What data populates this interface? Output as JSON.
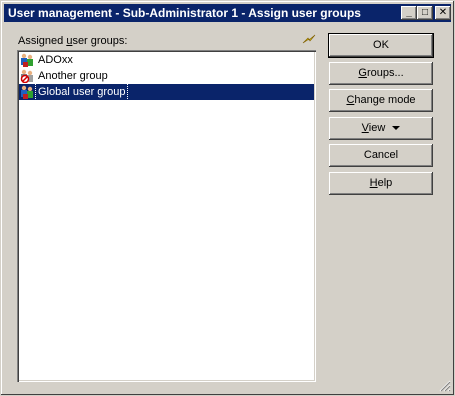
{
  "window": {
    "title": "User management - Sub-Administrator 1 - Assign user groups",
    "minimize_glyph": "_",
    "maximize_glyph": "□",
    "close_glyph": "✕"
  },
  "list": {
    "label_pre": "Assigned ",
    "label_underlined": "u",
    "label_post": "ser groups:",
    "items": [
      {
        "label": "ADOxx",
        "icon": "user-group-icon",
        "selected": false
      },
      {
        "label": "Another group",
        "icon": "user-group-blocked-icon",
        "selected": false
      },
      {
        "label": "Global user group",
        "icon": "user-group-icon",
        "selected": true
      }
    ]
  },
  "buttons": {
    "ok": "OK",
    "groups": {
      "u": "G",
      "rest": "roups..."
    },
    "change_mode": {
      "u": "C",
      "rest": "hange mode"
    },
    "view": {
      "u": "V",
      "rest": "iew"
    },
    "cancel": "Cancel",
    "help": {
      "u": "H",
      "rest": "elp"
    }
  },
  "icons": {
    "flash": "lightning-icon",
    "view_dropdown": "triangle-down-icon",
    "resize": "resize-grip-icon"
  },
  "colors": {
    "titlebar": "#0a246a",
    "selection": "#0a246a",
    "face": "#d4d0c8"
  }
}
